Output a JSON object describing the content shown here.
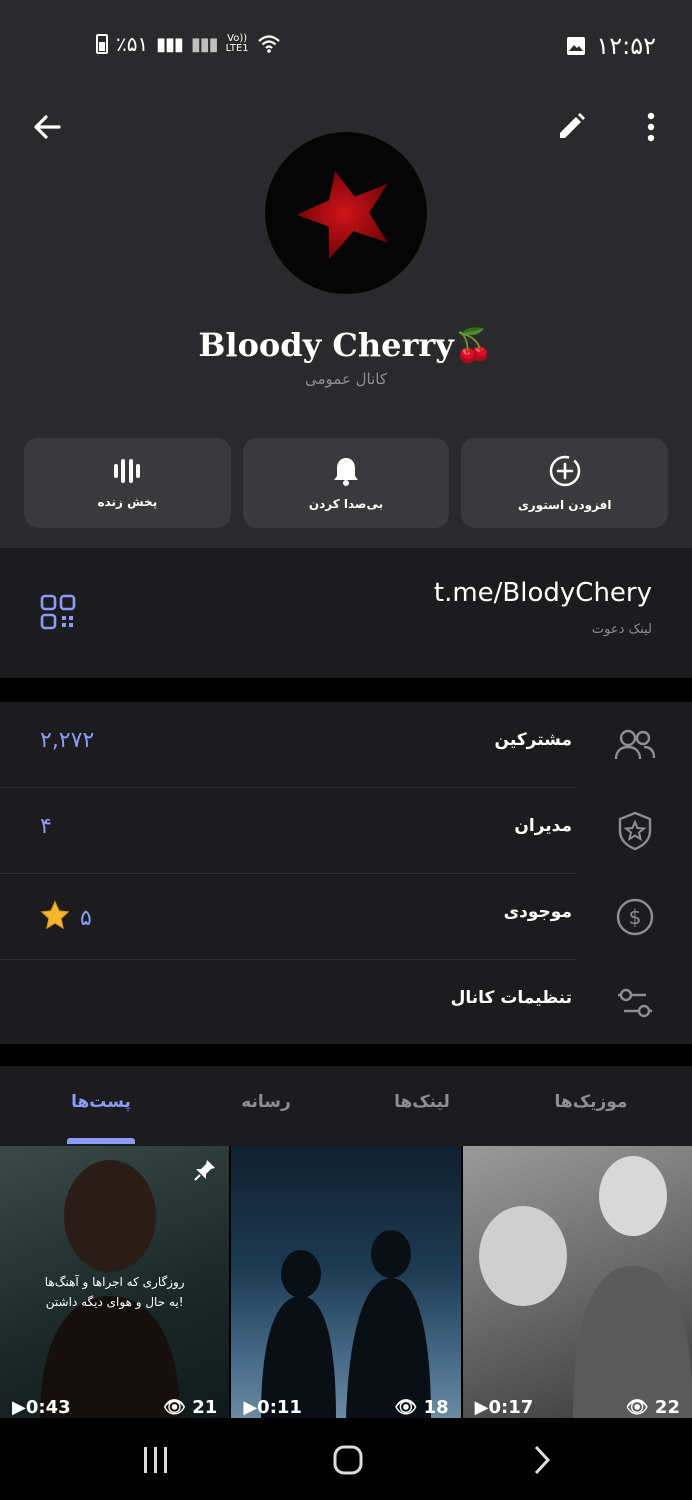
{
  "status_bar": {
    "time": "۱۲:۵۲",
    "battery": "٪۵۱",
    "network": "LTE1",
    "volte": "Vo))"
  },
  "header": {
    "back_icon": "arrow-left-icon",
    "edit_icon": "pencil-icon",
    "more_icon": "more-vertical-icon"
  },
  "channel": {
    "name": "Bloody Cherry🍒",
    "type": "کانال عمومی"
  },
  "actions": [
    {
      "label": "افزودن استوری",
      "icon": "add-story-icon"
    },
    {
      "label": "بی‌صدا کردن",
      "icon": "bell-icon"
    },
    {
      "label": "پخش زنده",
      "icon": "live-stream-icon"
    }
  ],
  "invite": {
    "link": "t.me/BlodyChery",
    "label": "لینک دعوت"
  },
  "info_rows": [
    {
      "label": "مشترکین",
      "value": "۲,۲۷۲",
      "icon": "users-icon"
    },
    {
      "label": "مدیران",
      "value": "۴",
      "icon": "shield-star-icon"
    },
    {
      "label": "موجودی",
      "value": "۵",
      "icon": "dollar-circle-icon"
    },
    {
      "label": "تنظیمات کانال",
      "value": "",
      "icon": "sliders-icon"
    }
  ],
  "tabs": [
    {
      "label": "پست‌ها",
      "active": true
    },
    {
      "label": "رسانه",
      "active": false
    },
    {
      "label": "لینک‌ها",
      "active": false
    },
    {
      "label": "موزیک‌ها",
      "active": false
    }
  ],
  "media": [
    {
      "duration": "0:43",
      "views": "21",
      "caption_line1": "روزگاری که اجراها و آهنگ‌ها",
      "caption_line2": "یه حال و هوای دیگه داشتن!",
      "pinned": true
    },
    {
      "duration": "0:11",
      "views": "18"
    },
    {
      "duration": "0:17",
      "views": "22"
    }
  ],
  "colors": {
    "accent": "#8a9cf7",
    "background": "#1c1c1e",
    "header_bg": "#2a2a2c",
    "button_bg": "#3a3a3c"
  }
}
